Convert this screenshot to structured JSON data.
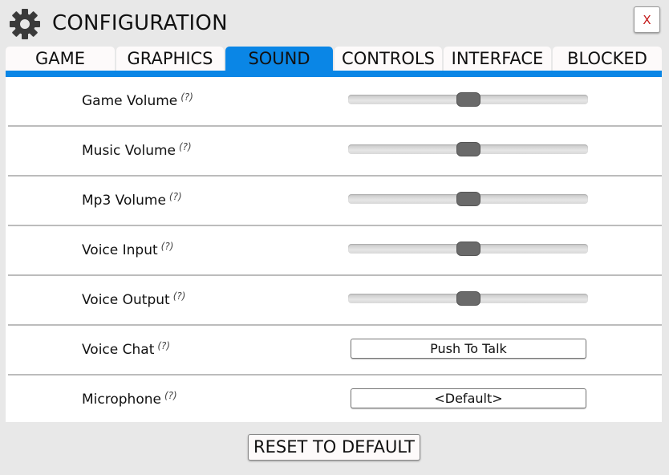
{
  "window": {
    "title": "CONFIGURATION",
    "icon": "gear-icon",
    "close_label": "X"
  },
  "tabs": [
    {
      "label": "GAME",
      "active": false
    },
    {
      "label": "GRAPHICS",
      "active": false
    },
    {
      "label": "SOUND",
      "active": true
    },
    {
      "label": "CONTROLS",
      "active": false
    },
    {
      "label": "INTERFACE",
      "active": false
    },
    {
      "label": "BLOCKED",
      "active": false
    }
  ],
  "settings": [
    {
      "label": "Game Volume",
      "help": "(?)",
      "type": "slider",
      "value": 0.5
    },
    {
      "label": "Music Volume",
      "help": "(?)",
      "type": "slider",
      "value": 0.5
    },
    {
      "label": "Mp3 Volume",
      "help": "(?)",
      "type": "slider",
      "value": 0.5
    },
    {
      "label": "Voice Input",
      "help": "(?)",
      "type": "slider",
      "value": 0.5
    },
    {
      "label": "Voice Output",
      "help": "(?)",
      "type": "slider",
      "value": 0.5
    },
    {
      "label": "Voice Chat",
      "help": "(?)",
      "type": "select",
      "value": "Push To Talk"
    },
    {
      "label": "Microphone",
      "help": "(?)",
      "type": "select",
      "value": "<Default>"
    }
  ],
  "footer": {
    "reset_label": "RESET TO DEFAULT"
  },
  "colors": {
    "accent": "#0a86e6",
    "close_x": "#c41a1a",
    "background": "#e8e8e8",
    "panel": "#ffffff"
  }
}
